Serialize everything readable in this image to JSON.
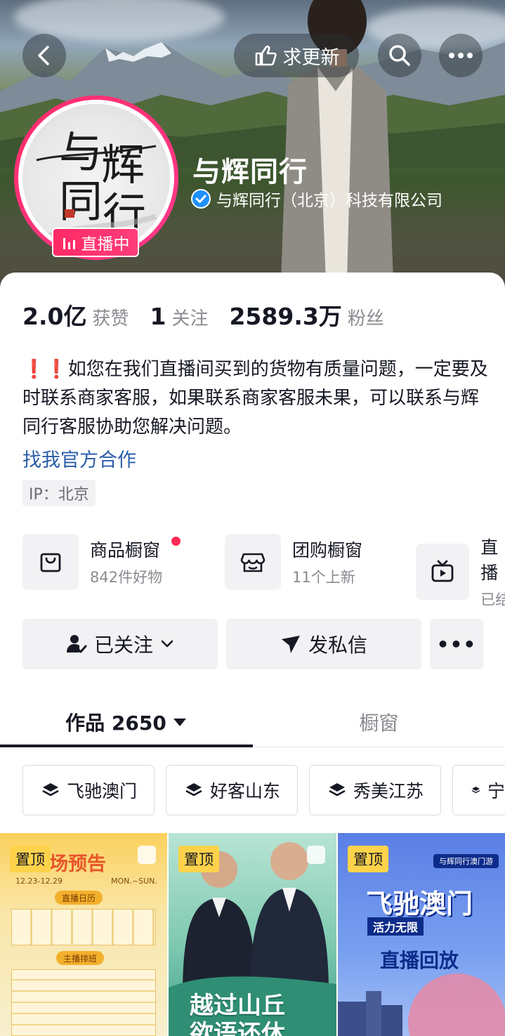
{
  "colors": {
    "accent_pink": "#fe2c55",
    "link_blue": "#2b5da8",
    "pin_yellow": "#fed24a",
    "verify_blue": "#1e90ff"
  },
  "header": {
    "update_label": "求更新",
    "profile_name": "与辉同行",
    "verified_org": "与辉同行（北京）科技有限公司",
    "live_label": "直播中",
    "avatar_text": [
      "与",
      "辉",
      "同",
      "行"
    ]
  },
  "stats": [
    {
      "value": "2.0亿",
      "label": "获赞"
    },
    {
      "value": "1",
      "label": "关注"
    },
    {
      "value": "2589.3万",
      "label": "粉丝"
    }
  ],
  "bio": {
    "warning_icon": "❗❗",
    "text": "如您在我们直播间买到的货物有质量问题，一定要及时联系商家客服，如果联系商家客服未果，可以联系与辉同行客服协助您解决问题。",
    "link": "找我官方合作",
    "ip": "IP：北京"
  },
  "shortcuts": [
    {
      "icon": "shopping-bag-icon",
      "title": "商品橱窗",
      "sub": "842件好物",
      "dot": true
    },
    {
      "icon": "store-icon",
      "title": "团购橱窗",
      "sub": "11个上新",
      "dot": false
    },
    {
      "icon": "tv-icon",
      "title": "直播",
      "sub": "已结",
      "dot": false
    }
  ],
  "actions": {
    "follow_label": "已关注",
    "message_label": "发私信",
    "more_label": "•••"
  },
  "tabs": [
    {
      "label": "作品 2650",
      "active": true
    },
    {
      "label": "橱窗",
      "active": false
    }
  ],
  "collections": [
    "飞驰澳门",
    "好客山东",
    "秀美江苏",
    "宁"
  ],
  "tiles": [
    {
      "pin": "置顶",
      "caption": "场预告",
      "sub": "12.23-12.29",
      "week": "MON.~SUN.",
      "sched": "直播日历",
      "hosts": "主播排班"
    },
    {
      "pin": "置顶",
      "caption": "越过山丘",
      "caption2": "欲语还休"
    },
    {
      "pin": "置顶",
      "caption": "飞驰澳门",
      "slogan": "活力无限",
      "sub": "直播回放",
      "brand": "与辉同行澳门游"
    }
  ]
}
